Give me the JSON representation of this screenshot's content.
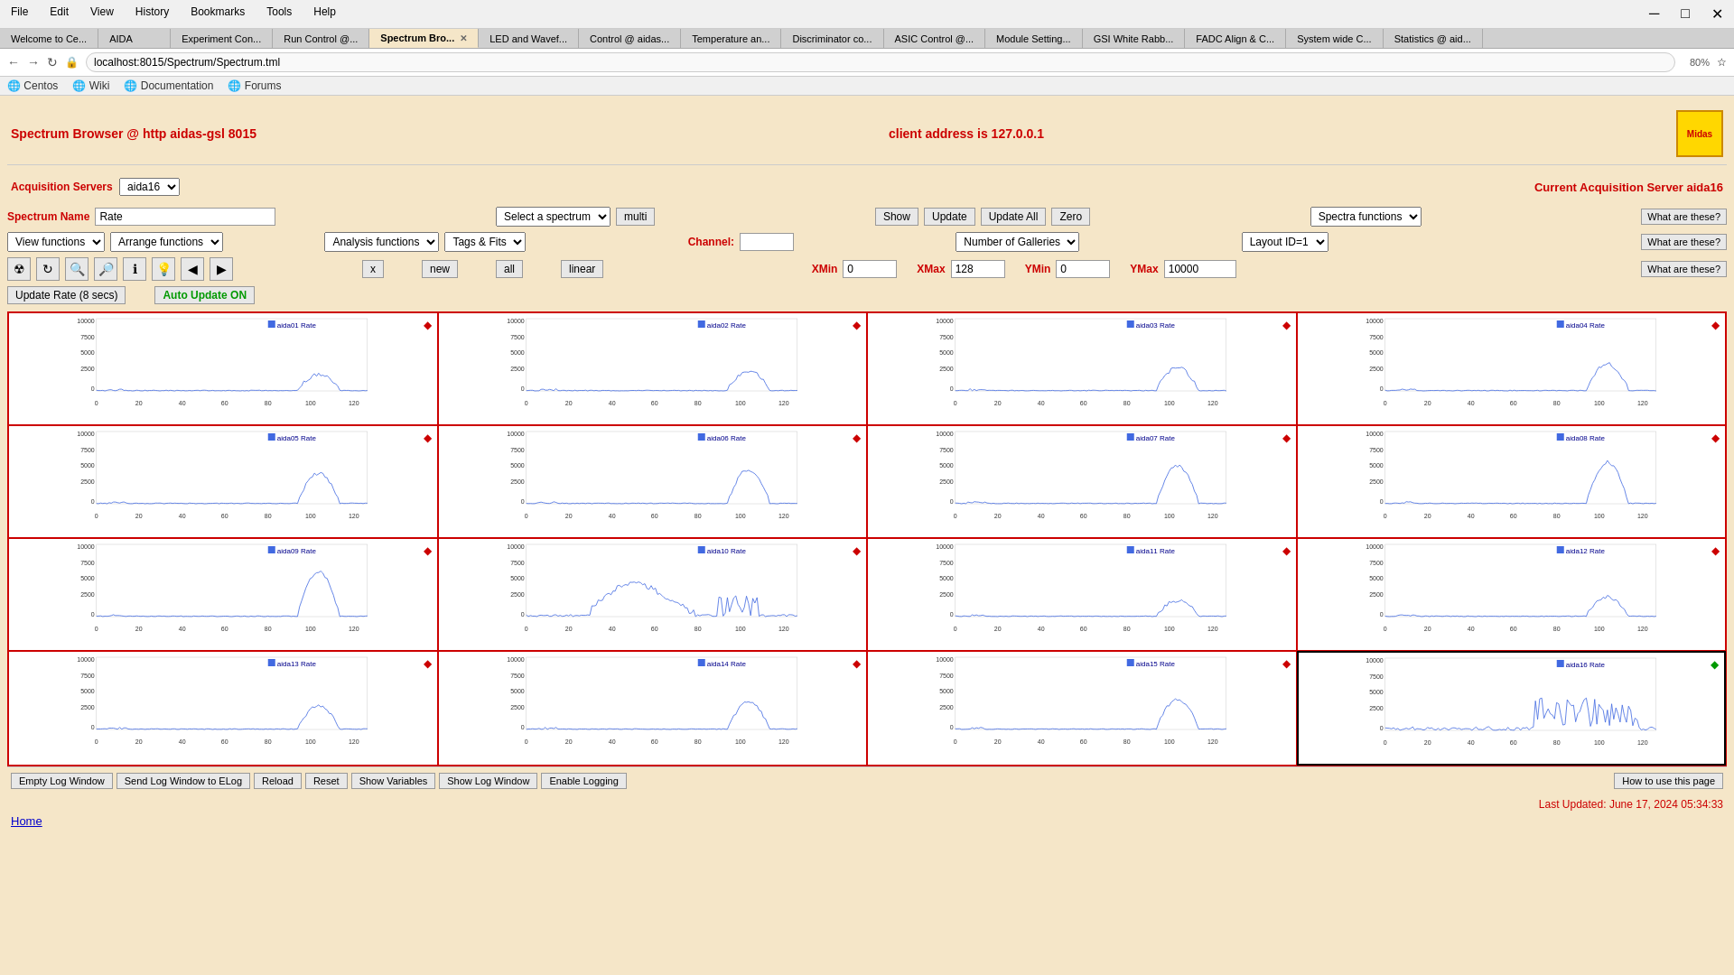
{
  "browser": {
    "menu": [
      "File",
      "Edit",
      "View",
      "History",
      "Bookmarks",
      "Tools",
      "Help"
    ],
    "tabs": [
      {
        "label": "Welcome to Ce...",
        "active": false
      },
      {
        "label": "AIDA",
        "active": false
      },
      {
        "label": "Experiment Con...",
        "active": false
      },
      {
        "label": "Run Control @...",
        "active": false
      },
      {
        "label": "Spectrum Bro...",
        "active": true,
        "closeable": true
      },
      {
        "label": "LED and Wavef...",
        "active": false
      },
      {
        "label": "Control @ aidas...",
        "active": false
      },
      {
        "label": "Temperature an...",
        "active": false
      },
      {
        "label": "Discriminator co...",
        "active": false
      },
      {
        "label": "ASIC Control @...",
        "active": false
      },
      {
        "label": "Module Setting...",
        "active": false
      },
      {
        "label": "GSI White Rabb...",
        "active": false
      },
      {
        "label": "FADC Align & C...",
        "active": false
      },
      {
        "label": "System wide C...",
        "active": false
      },
      {
        "label": "Statistics @ aid...",
        "active": false
      }
    ],
    "url": "localhost:8015/Spectrum/Spectrum.tml",
    "zoom": "80%",
    "bookmarks": [
      "Centos",
      "Wiki",
      "Documentation",
      "Forums"
    ]
  },
  "page": {
    "title": "Spectrum Browser @ http aidas-gsl 8015",
    "client_address": "client address is 127.0.0.1",
    "acquisition_servers_label": "Acquisition Servers",
    "acquisition_server_value": "aida16",
    "current_acq_label": "Current Acquisition Server aida16",
    "spectrum_name_label": "Spectrum Name",
    "spectrum_name_value": "Rate",
    "select_spectrum_label": "Select a spectrum",
    "multi_label": "multi",
    "show_label": "Show",
    "update_label": "Update",
    "update_all_label": "Update All",
    "zero_label": "Zero",
    "spectra_functions_label": "Spectra functions",
    "what_these1": "What are these?",
    "what_these2": "What are these?",
    "what_these3": "What are these?",
    "view_functions_label": "View functions",
    "arrange_functions_label": "Arrange functions",
    "analysis_functions_label": "Analysis functions",
    "tags_fits_label": "Tags & Fits",
    "channel_label": "Channel:",
    "channel_value": "",
    "number_galleries_label": "Number of Galleries",
    "layout_label": "Layout ID=1",
    "x_btn": "x",
    "new_btn": "new",
    "all_btn": "all",
    "linear_btn": "linear",
    "xmin_label": "XMin",
    "xmin_value": "0",
    "xmax_label": "XMax",
    "xmax_value": "128",
    "ymin_label": "YMin",
    "ymin_value": "0",
    "ymax_label": "YMax",
    "ymax_value": "10000",
    "update_rate_btn": "Update Rate (8 secs)",
    "auto_update_btn": "Auto Update ON",
    "charts": [
      {
        "id": "aida01",
        "title": "aida01 Rate",
        "diamond": "red"
      },
      {
        "id": "aida02",
        "title": "aida02 Rate",
        "diamond": "red"
      },
      {
        "id": "aida03",
        "title": "aida03 Rate",
        "diamond": "red"
      },
      {
        "id": "aida04",
        "title": "aida04 Rate",
        "diamond": "red"
      },
      {
        "id": "aida05",
        "title": "aida05 Rate",
        "diamond": "red"
      },
      {
        "id": "aida06",
        "title": "aida06 Rate",
        "diamond": "red"
      },
      {
        "id": "aida07",
        "title": "aida07 Rate",
        "diamond": "red"
      },
      {
        "id": "aida08",
        "title": "aida08 Rate",
        "diamond": "red"
      },
      {
        "id": "aida09",
        "title": "aida09 Rate",
        "diamond": "red"
      },
      {
        "id": "aida10",
        "title": "aida10 Rate",
        "diamond": "red"
      },
      {
        "id": "aida11",
        "title": "aida11 Rate",
        "diamond": "red"
      },
      {
        "id": "aida12",
        "title": "aida12 Rate",
        "diamond": "red"
      },
      {
        "id": "aida13",
        "title": "aida13 Rate",
        "diamond": "red"
      },
      {
        "id": "aida14",
        "title": "aida14 Rate",
        "diamond": "red"
      },
      {
        "id": "aida15",
        "title": "aida15 Rate",
        "diamond": "red"
      },
      {
        "id": "aida16",
        "title": "aida16 Rate",
        "diamond": "green"
      }
    ],
    "bottom_buttons": [
      "Empty Log Window",
      "Send Log Window to ELog",
      "Reload",
      "Reset",
      "Show Variables",
      "Show Log Window",
      "Enable Logging"
    ],
    "how_to": "How to use this page",
    "last_updated": "Last Updated: June 17, 2024 05:34:33",
    "home_link": "Home"
  }
}
